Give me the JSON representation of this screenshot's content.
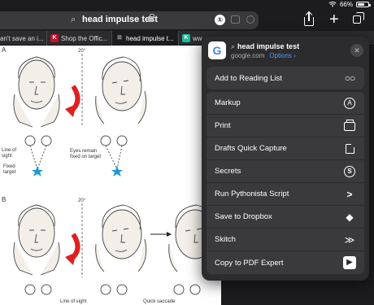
{
  "status_bar": {
    "battery": "66%"
  },
  "address_bar": {
    "query": "head impulse test"
  },
  "tabs": [
    {
      "label": "an't save an i...",
      "favicon": ""
    },
    {
      "label": "Shop the Offic...",
      "favicon": "K",
      "favicon_color": "#c8102e"
    },
    {
      "label": "head impulse t...",
      "favicon": "⊠",
      "favicon_color": "#888888"
    },
    {
      "label": "ww",
      "favicon": "K",
      "favicon_color": "#1abc9c"
    }
  ],
  "page": {
    "panel_a": "A",
    "panel_b": "B",
    "angle": "20°",
    "labels_a": {
      "line_of_sight": "Line of\nsight",
      "fixed_target": "Fixed\ntarget",
      "eyes_remain": "Eyes remain\nfixed on target"
    },
    "labels_b": {
      "line_of_sight": "Line of sight",
      "quick_saccade": "Quick saccade"
    }
  },
  "share_sheet": {
    "header_title": "head impulse test",
    "header_domain": "google.com",
    "header_options": "Options ›",
    "group1": [
      {
        "label": "Add to Reading List",
        "icon": "glasses-icon"
      }
    ],
    "group2": [
      {
        "label": "Markup",
        "icon": "markup-icon"
      },
      {
        "label": "Print",
        "icon": "print-icon"
      },
      {
        "label": "Drafts Quick Capture",
        "icon": "drafts-icon"
      },
      {
        "label": "Secrets",
        "icon": "secrets-icon"
      },
      {
        "label": "Run Pythonista Script",
        "icon": "pythonista-icon"
      },
      {
        "label": "Save to Dropbox",
        "icon": "dropbox-icon"
      },
      {
        "label": "Skitch",
        "icon": "skitch-icon"
      },
      {
        "label": "Copy to PDF Expert",
        "icon": "pdf-expert-icon"
      }
    ]
  },
  "colors": {
    "target_star": "#1e9ad6",
    "arrow_red": "#e02020",
    "link_blue": "#4a9eff"
  }
}
